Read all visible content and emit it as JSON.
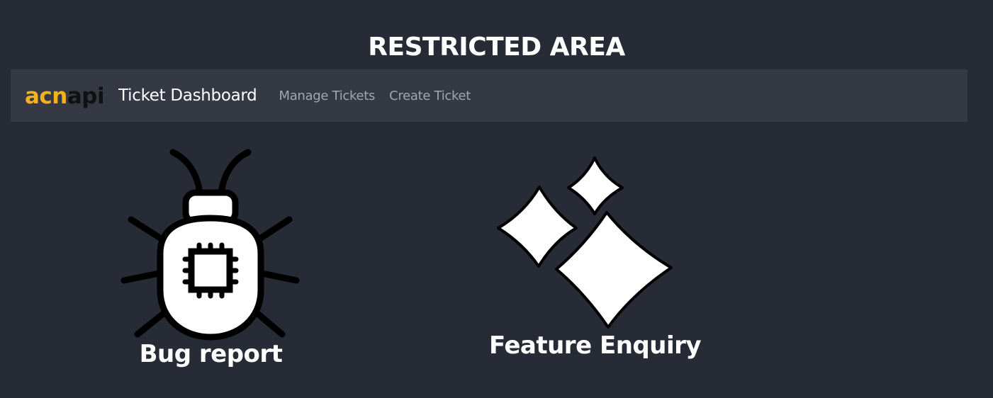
{
  "page": {
    "title": "RESTRICTED AREA"
  },
  "navbar": {
    "logo_part1": "acn",
    "logo_part2": "api",
    "brand_title": "Ticket Dashboard",
    "links": [
      {
        "label": "Manage Tickets"
      },
      {
        "label": "Create Ticket"
      }
    ]
  },
  "cards": [
    {
      "label": "Bug report",
      "icon": "bug-icon"
    },
    {
      "label": "Feature Enquiry",
      "icon": "sparkles-icon"
    }
  ],
  "colors": {
    "background": "#272b35",
    "navbar": "#353943",
    "logo_accent": "#f2b21c",
    "nav_link": "#a3a6ab"
  }
}
